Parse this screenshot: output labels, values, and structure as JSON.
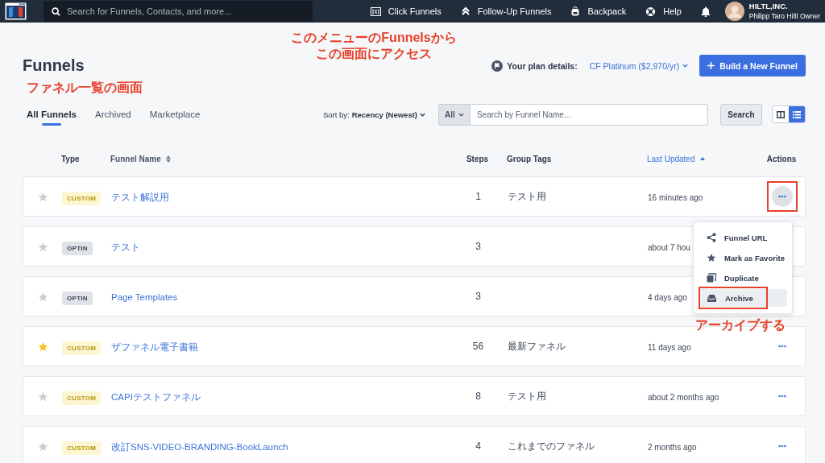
{
  "topbar": {
    "search_placeholder": "Search for Funnels, Contacts, and more...",
    "nav": [
      {
        "label": "Click Funnels"
      },
      {
        "label": "Follow-Up Funnels"
      },
      {
        "label": "Backpack"
      },
      {
        "label": "Help"
      }
    ],
    "company": "HILTL,INC.",
    "user": "Philipp Taro Hiltl Owner"
  },
  "nav_note": [
    "このメニューのFunnelsから",
    "この画面にアクセス"
  ],
  "title": "Funnels",
  "plan_label": "Your plan details:",
  "plan_value": "CF Platinum ($2,970/yr)",
  "build_button": "Build a New Funnel",
  "title_note": "ファネル一覧の画面",
  "tabs": [
    {
      "label": "All Funnels",
      "selected": true
    },
    {
      "label": "Archived",
      "selected": false
    },
    {
      "label": "Marketplace",
      "selected": false
    }
  ],
  "sort_label": "Sort by:",
  "sort_value": "Recency (Newest)",
  "filter": "All",
  "search_placeholder": "Search by Funnel Name...",
  "search_button": "Search",
  "view_modes": [
    {
      "kind": "columns",
      "selected": false
    },
    {
      "kind": "list",
      "selected": true
    }
  ],
  "columns": [
    {
      "label": "Type",
      "sortable": false
    },
    {
      "label": "Funnel Name",
      "sortable": true,
      "sorted": false
    },
    {
      "label": "Steps",
      "sortable": false
    },
    {
      "label": "Group Tags",
      "sortable": false
    },
    {
      "label": "Last Updated",
      "sortable": true,
      "sorted": true
    },
    {
      "label": "Actions",
      "sortable": false
    }
  ],
  "rows": [
    {
      "favorite": false,
      "type": "CUSTOM",
      "kind": "custom",
      "name": "テスト解説用",
      "steps": "1",
      "tags": "テスト用",
      "updated": "16 minutes ago",
      "menu_button": true,
      "menu_open": true
    },
    {
      "favorite": false,
      "type": "OPTIN",
      "kind": "optin",
      "name": "テスト",
      "steps": "3",
      "updated": "about 7 hou",
      "menu_button": false
    },
    {
      "favorite": false,
      "type": "OPTIN",
      "kind": "optin",
      "name": "Page Templates",
      "steps": "3",
      "updated": "4 days ago",
      "menu_button": false
    },
    {
      "favorite": true,
      "type": "CUSTOM",
      "kind": "custom",
      "name": "ザファネル電子書籍",
      "steps": "56",
      "tags": "最新ファネル",
      "updated": "11 days ago",
      "menu_button": true,
      "menu_open": false
    },
    {
      "favorite": false,
      "type": "CUSTOM",
      "kind": "custom",
      "name": "CAPIテストファネル",
      "steps": "8",
      "tags": "テスト用",
      "updated": "about 2 months ago",
      "menu_button": true,
      "menu_open": false
    },
    {
      "favorite": false,
      "type": "CUSTOM",
      "kind": "custom",
      "name": "改訂SNS-VIDEO-BRANDING-BookLaunch",
      "steps": "4",
      "tags": "これまでのファネル",
      "updated": "2 months ago",
      "menu_button": true,
      "menu_open": false
    }
  ],
  "menu": {
    "items": [
      {
        "label": "Funnel URL",
        "highlighted": false
      },
      {
        "label": "Mark as Favorite",
        "highlighted": false
      },
      {
        "label": "Duplicate",
        "highlighted": false
      },
      {
        "label": "Archive",
        "highlighted": true
      }
    ],
    "note": "アーカイブする"
  }
}
